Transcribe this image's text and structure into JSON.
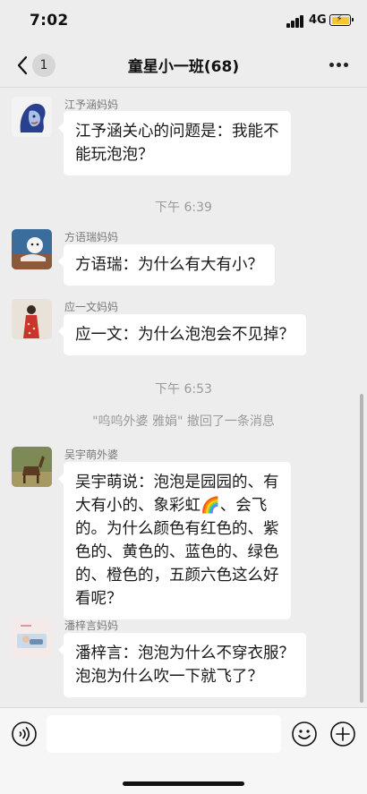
{
  "status_bar": {
    "time": "7:02",
    "network": "4G"
  },
  "header": {
    "unread_count": "1",
    "title": "童星小一班(68)"
  },
  "messages": [
    {
      "sender": "江予涵妈妈",
      "text": "江予涵关心的问题是：我能不\n能玩泡泡？"
    },
    {
      "sender": "方语瑞妈妈",
      "text": "方语瑞：为什么有大有小？"
    },
    {
      "sender": "应一文妈妈",
      "text": "应一文：为什么泡泡会不见掉？"
    },
    {
      "sender": "吴宇萌外婆",
      "text": "吴宇萌说：泡泡是园园的、有\n大有小的、象彩虹🌈、会飞\n的。为什么颜色有红色的、紫\n色的、黄色的、蓝色的、绿色\n的、橙色的，五颜六色这么好\n看呢？"
    },
    {
      "sender": "潘梓言妈妈",
      "text": "潘梓言：泡泡为什么不穿衣服？\n泡泡为什么吹一下就飞了？"
    }
  ],
  "timestamps": [
    "下午 6:39",
    "下午 6:53"
  ],
  "system_notice": "\"呜呜外婆 雅娟\" 撤回了一条消息",
  "input": {
    "value": ""
  },
  "icons": {
    "back": "back-chevron-icon",
    "more": "more-dots-icon",
    "voice": "voice-icon",
    "emoji": "emoji-icon",
    "plus": "plus-icon"
  },
  "colors": {
    "background": "#ededed",
    "bubble": "#ffffff",
    "battery": "#f6c730"
  }
}
